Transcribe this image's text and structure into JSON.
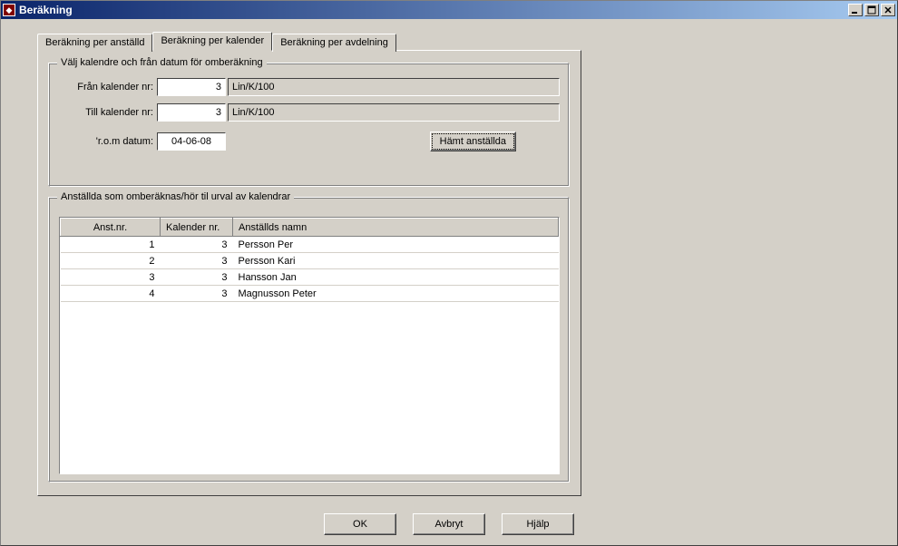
{
  "window": {
    "title": "Beräkning"
  },
  "tabs": [
    {
      "label": "Beräkning per anställd"
    },
    {
      "label": "Beräkning per kalender"
    },
    {
      "label": "Beräkning per avdelning"
    }
  ],
  "group1": {
    "legend": "Välj kalendre och från datum för omberäkning",
    "from_label": "Från kalender nr:",
    "from_value": "3",
    "from_desc": "Lin/K/100",
    "to_label": "Till kalender nr:",
    "to_value": "3",
    "to_desc": "Lin/K/100",
    "date_label": "'r.o.m datum:",
    "date_value": "04-06-08",
    "fetch_button": "Hämt anställda"
  },
  "group2": {
    "legend": "Anställda som omberäknas/hör til urval av kalendrar",
    "columns": [
      "Anst.nr.",
      "Kalender nr.",
      "Anställds namn"
    ],
    "rows": [
      {
        "anst": "1",
        "kal": "3",
        "name": "Persson Per"
      },
      {
        "anst": "2",
        "kal": "3",
        "name": "Persson Kari"
      },
      {
        "anst": "3",
        "kal": "3",
        "name": "Hansson Jan"
      },
      {
        "anst": "4",
        "kal": "3",
        "name": "Magnusson Peter"
      }
    ]
  },
  "buttons": {
    "ok": "OK",
    "cancel": "Avbryt",
    "help": "Hjälp"
  }
}
